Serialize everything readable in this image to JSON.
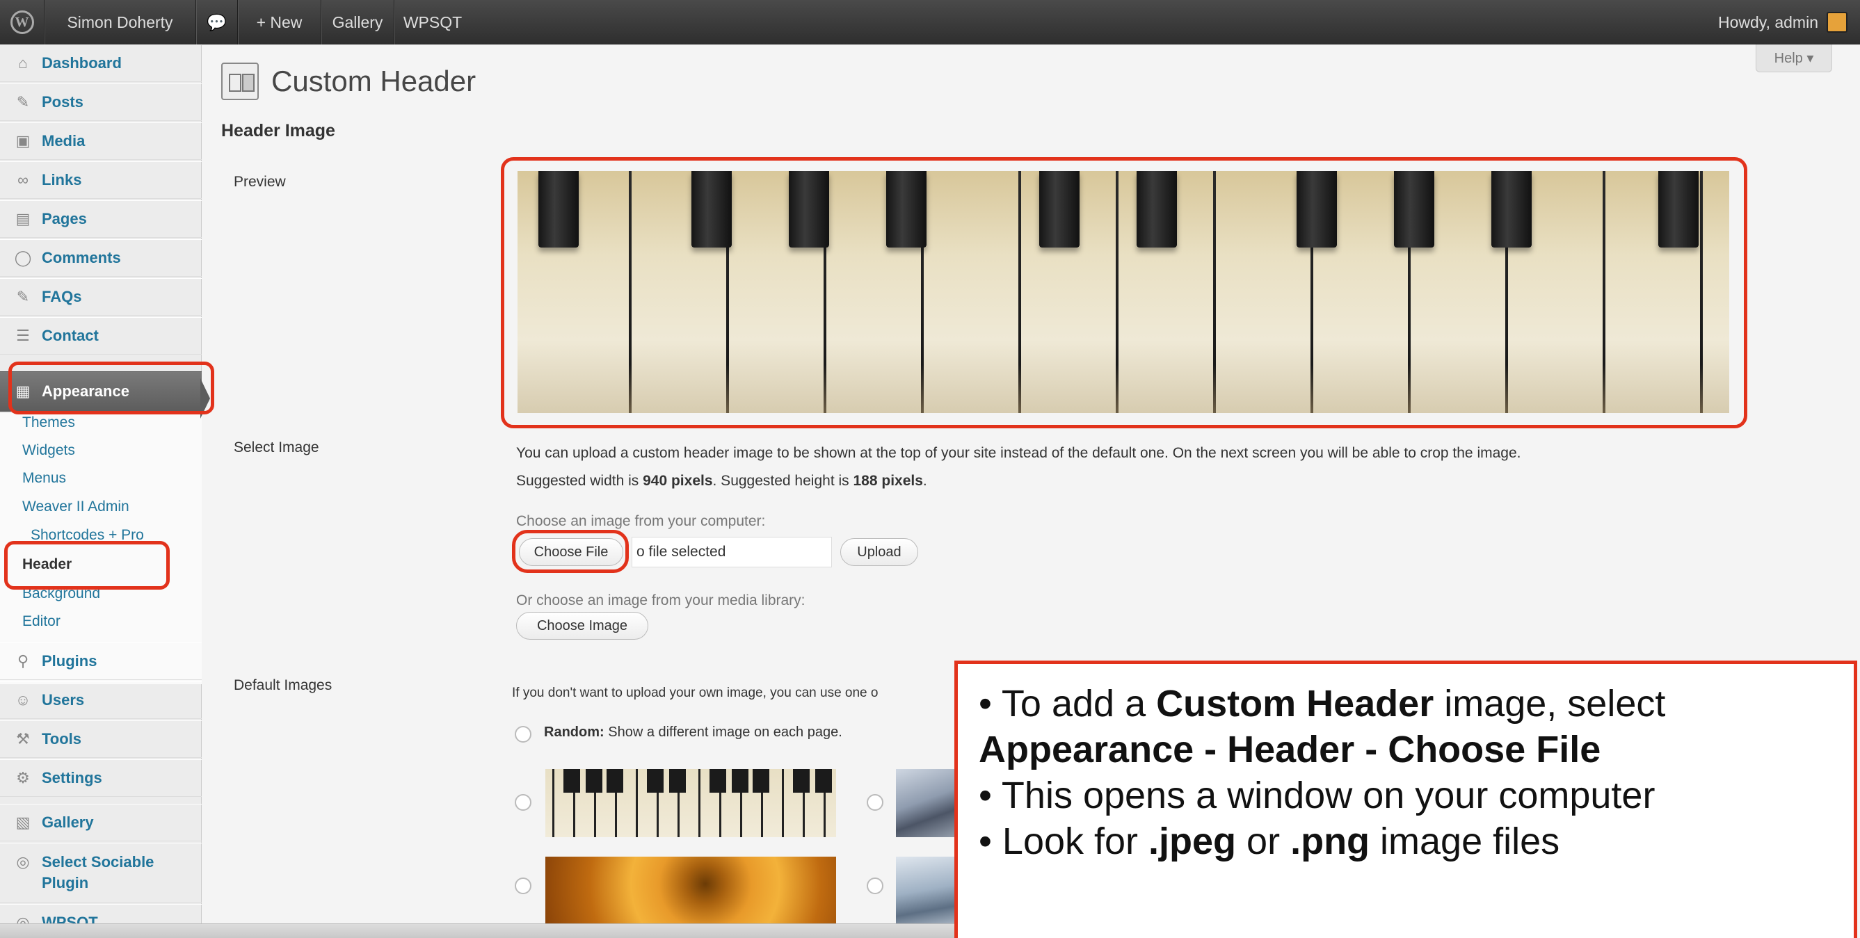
{
  "adminbar": {
    "site_name": "Simon Doherty",
    "new_label": "+ New",
    "gallery_label": "Gallery",
    "wpsqt_label": "WPSQT",
    "howdy": "Howdy, admin"
  },
  "sidebar": {
    "items": [
      {
        "label": "Dashboard",
        "icon": "home-icon"
      },
      {
        "label": "Posts",
        "icon": "pin-icon"
      },
      {
        "label": "Media",
        "icon": "media-icon"
      },
      {
        "label": "Links",
        "icon": "link-icon"
      },
      {
        "label": "Pages",
        "icon": "page-icon"
      },
      {
        "label": "Comments",
        "icon": "comment-icon"
      },
      {
        "label": "FAQs",
        "icon": "pin-icon"
      },
      {
        "label": "Contact",
        "icon": "contact-icon"
      },
      {
        "label": "Appearance",
        "icon": "appearance-icon"
      },
      {
        "label": "Plugins",
        "icon": "plugin-icon"
      },
      {
        "label": "Users",
        "icon": "users-icon"
      },
      {
        "label": "Tools",
        "icon": "tools-icon"
      },
      {
        "label": "Settings",
        "icon": "settings-icon"
      },
      {
        "label": "Gallery",
        "icon": "gallery-icon"
      },
      {
        "label": "Select Sociable",
        "label2": "Plugin",
        "icon": "sociable-icon"
      },
      {
        "label": "WPSQT",
        "icon": "quiz-icon"
      }
    ],
    "appearance_sub": [
      "Themes",
      "Widgets",
      "Menus",
      "Weaver II Admin",
      "Shortcodes + Pro",
      "Header",
      "Background",
      "Editor"
    ]
  },
  "page": {
    "title": "Custom Header",
    "help": "Help ▾",
    "section_title": "Header Image",
    "preview_label": "Preview",
    "select_label": "Select Image",
    "default_label": "Default Images",
    "upload_text_1": "You can upload a custom header image to be shown at the top of your site instead of the default one. On the next screen you will be able to crop the image.",
    "suggested_prefix": "Suggested width is ",
    "suggested_width": "940 pixels",
    "suggested_mid": ". Suggested height is ",
    "suggested_height": "188 pixels",
    "suggested_suffix": ".",
    "choose_computer": "Choose an image from your computer:",
    "choose_file": "Choose File",
    "no_file": "o file selected",
    "upload": "Upload",
    "choose_media": "Or choose an image from your media library:",
    "choose_image": "Choose Image",
    "default_text": "If you don't want to upload your own image, you can use one o",
    "random_bold": "Random:",
    "random_text": " Show a different image on each page."
  },
  "callout": {
    "l1_pre": "• To add a ",
    "l1_bold": "Custom Header",
    "l1_post": " image, select",
    "l2_bold": "Appearance - Header - Choose File",
    "l3": "• This opens a window on your computer",
    "l4_pre": "• Look for ",
    "l4_b1": ".jpeg",
    "l4_mid": " or ",
    "l4_b2": ".png",
    "l4_post": " image files"
  },
  "colors": {
    "highlight": "#e2321b",
    "link": "#21759b"
  }
}
